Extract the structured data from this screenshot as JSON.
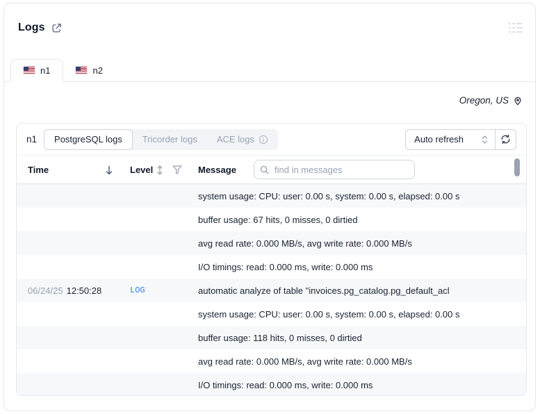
{
  "window": {
    "title": "Logs"
  },
  "tabs": [
    {
      "label": "n1",
      "active": true
    },
    {
      "label": "n2",
      "active": false
    }
  ],
  "region": {
    "label": "Oregon, US"
  },
  "toolbar": {
    "node_label": "n1",
    "segments": [
      {
        "label": "PostgreSQL logs",
        "active": true
      },
      {
        "label": "Tricorder logs",
        "active": false
      },
      {
        "label": "ACE logs",
        "active": false,
        "info_icon": true
      }
    ],
    "auto_refresh_label": "Auto refresh"
  },
  "table": {
    "columns": {
      "time": "Time",
      "level": "Level",
      "message": "Message"
    },
    "sort": {
      "time": "descending"
    },
    "search_placeholder": "find in messages",
    "rows": [
      {
        "date": "",
        "time": "",
        "level": "",
        "message": "system usage: CPU: user: 0.00 s, system: 0.00 s, elapsed: 0.00 s"
      },
      {
        "date": "",
        "time": "",
        "level": "",
        "message": "buffer usage: 67 hits, 0 misses, 0 dirtied"
      },
      {
        "date": "",
        "time": "",
        "level": "",
        "message": "avg read rate: 0.000 MB/s, avg write rate: 0.000 MB/s"
      },
      {
        "date": "",
        "time": "",
        "level": "",
        "message": "I/O timings: read: 0.000 ms, write: 0.000 ms"
      },
      {
        "date": "06/24/25",
        "time": "12:50:28",
        "level": "LOG",
        "message": "automatic analyze of table \"invoices.pg_catalog.pg_default_acl"
      },
      {
        "date": "",
        "time": "",
        "level": "",
        "message": "system usage: CPU: user: 0.00 s, system: 0.00 s, elapsed: 0.00 s"
      },
      {
        "date": "",
        "time": "",
        "level": "",
        "message": "buffer usage: 118 hits, 0 misses, 0 dirtied"
      },
      {
        "date": "",
        "time": "",
        "level": "",
        "message": "avg read rate: 0.000 MB/s, avg write rate: 0.000 MB/s"
      },
      {
        "date": "",
        "time": "",
        "level": "",
        "message": "I/O timings: read: 0.000 ms, write: 0.000 ms"
      }
    ]
  },
  "colors": {
    "level_log_blue": "#2e7ee5",
    "stripe": "#f7f8fa",
    "border": "#e4e7ec",
    "muted_text": "#98a2b3"
  }
}
